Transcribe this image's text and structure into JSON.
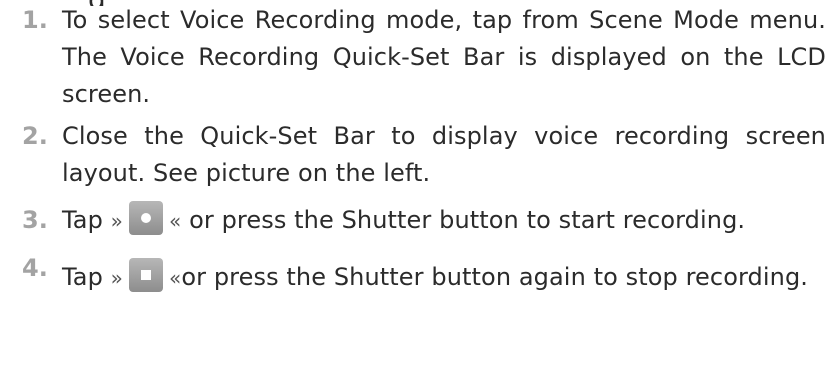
{
  "steps": [
    {
      "number": "1.",
      "text": "To select Voice Recording mode, tap from Scene Mode menu. The Voice Recording Quick-Set Bar is displayed on the LCD screen."
    },
    {
      "number": "2.",
      "text": "Close the Quick-Set Bar to display voice recording screen layout. See picture on the left."
    },
    {
      "number": "3.",
      "text_before": "Tap",
      "guillemet_open": "»",
      "guillemet_close": "«",
      "text_after": "or press the Shutter button to start recording.",
      "icon": "record-icon"
    },
    {
      "number": "4.",
      "text_before": "Tap",
      "guillemet_open": "»",
      "guillemet_close": "«",
      "text_after": "or press the Shutter button again to stop recording.",
      "icon": "stop-icon"
    }
  ],
  "colors": {
    "number": "#a3a3a3",
    "text": "#2b2b2b",
    "icon_bg": "#a0a0a0"
  }
}
